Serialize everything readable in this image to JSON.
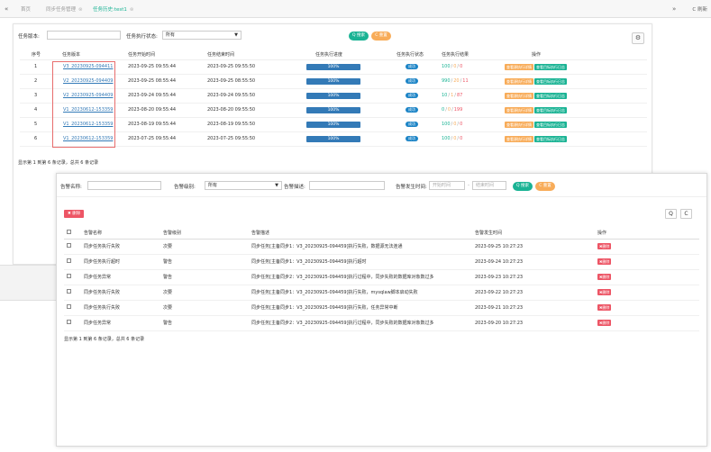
{
  "tabs": {
    "prev_icon": "«",
    "items": [
      {
        "label": "首页",
        "closable": false
      },
      {
        "label": "同步任务管理",
        "closable": true
      },
      {
        "label": "任务历史:test1",
        "closable": true,
        "active": true
      }
    ],
    "next_icon": "»",
    "refresh_label": "C 刷新"
  },
  "history": {
    "search": {
      "version_label": "任务版本:",
      "state_label": "任务执行状态:",
      "state_value": "所有",
      "search_btn": "Q 搜索",
      "reset_btn": "C 重置"
    },
    "columns": [
      "序号",
      "任务版本",
      "任务开始时间",
      "任务结束时间",
      "任务执行进度",
      "任务执行状态",
      "任务执行结果",
      "操作"
    ],
    "rows": [
      {
        "no": "1",
        "version": "V3_20230925-094411",
        "start": "2023-09-25 09:55:44",
        "end": "2023-09-25 09:55:50",
        "progress": "100%",
        "state": "成功",
        "ok": "100",
        "warn": "0",
        "err": "0"
      },
      {
        "no": "2",
        "version": "V2_20230925-094409",
        "start": "2023-09-25 08:55:44",
        "end": "2023-09-25 08:55:50",
        "progress": "100%",
        "state": "成功",
        "ok": "990",
        "warn": "20",
        "err": "11"
      },
      {
        "no": "3",
        "version": "V2_20230925-094409",
        "start": "2023-09-24 09:55:44",
        "end": "2023-09-24 09:55:50",
        "progress": "100%",
        "state": "成功",
        "ok": "10",
        "warn": "1",
        "err": "87"
      },
      {
        "no": "4",
        "version": "V1_20230612-153359",
        "start": "2023-08-20 09:55:44",
        "end": "2023-08-20 09:55:50",
        "progress": "100%",
        "state": "成功",
        "ok": "0",
        "warn": "0",
        "err": "199"
      },
      {
        "no": "5",
        "version": "V1_20230612-153359",
        "start": "2023-08-19 09:55:44",
        "end": "2023-08-19 09:55:50",
        "progress": "100%",
        "state": "成功",
        "ok": "100",
        "warn": "0",
        "err": "0"
      },
      {
        "no": "6",
        "version": "V1_20230612-153359",
        "start": "2023-07-25 09:55:44",
        "end": "2023-07-25 09:55:50",
        "progress": "100%",
        "state": "成功",
        "ok": "100",
        "warn": "0",
        "err": "0"
      }
    ],
    "op_buttons": [
      "查看源执行详情",
      "查看目标执行日志"
    ],
    "result_sep": "/",
    "footer": "显示第 1 到第 6 条记录，总共 6 条记录"
  },
  "alerts": {
    "search": {
      "name_label": "告警名称:",
      "level_label": "告警级别:",
      "level_value": "所有",
      "desc_label": "告警描述:",
      "time_label": "告警发生时间:",
      "start_placeholder": "开始时间",
      "time_sep": "-",
      "end_placeholder": "结束时间",
      "search_btn": "Q 搜索",
      "reset_btn": "C 重置"
    },
    "delete_btn": "✖ 删除",
    "search_icon": "Q",
    "refresh_icon": "C",
    "columns": [
      "告警名称",
      "告警级别",
      "告警描述",
      "告警发生时间",
      "操作"
    ],
    "rows": [
      {
        "name": "同步任务执行失败",
        "level": "次要",
        "desc": "同步任务[主备同步1：V3_20230925-094459]执行失败，数据源无法连通",
        "time": "2023-09-25 10:27:23"
      },
      {
        "name": "同步任务执行超时",
        "level": "警告",
        "desc": "同步任务[主备同步1：V3_20230925-094459]执行超时",
        "time": "2023-09-24 10:27:23"
      },
      {
        "name": "同步任务异常",
        "level": "警告",
        "desc": "同步任务[主备同步2：V3_20230925-094459]执行过程中，同步失败的数据库对象数过多",
        "time": "2023-09-23 10:27:23"
      },
      {
        "name": "同步任务执行失败",
        "level": "次要",
        "desc": "同步任务[主备同步1：V3_20230925-094459]执行失败，mysqlaw脚本启动失败",
        "time": "2023-09-22 10:27:23"
      },
      {
        "name": "同步任务执行失败",
        "level": "次要",
        "desc": "同步任务[主备同步1：V3_20230925-094459]执行失败，任务异常中断",
        "time": "2023-09-21 10:27:23"
      },
      {
        "name": "同步任务异常",
        "level": "警告",
        "desc": "同步任务[主备同步2：V3_20230925-094459]执行过程中，同步失败的数据库对象数过多",
        "time": "2023-09-20 10:27:23"
      }
    ],
    "row_delete": "✖删除",
    "footer": "显示第 1 到第 6 条记录，总共 6 条记录"
  }
}
